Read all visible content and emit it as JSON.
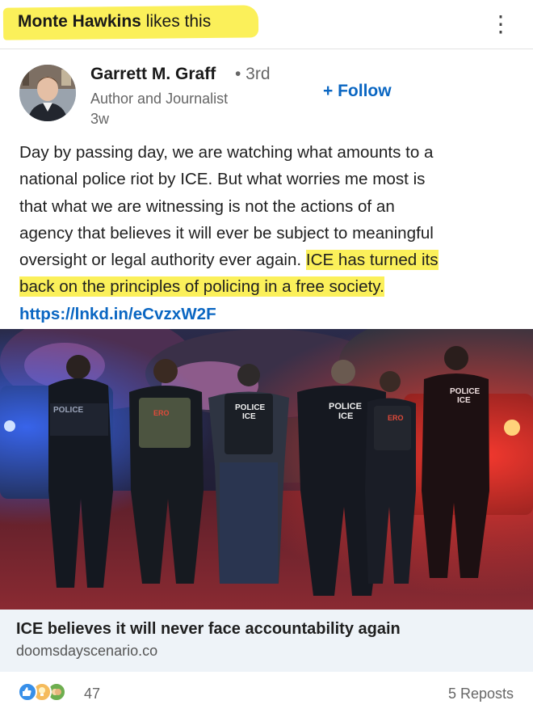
{
  "social_context": {
    "actor": "Monte Hawkins",
    "action": "likes this"
  },
  "author": {
    "name": "Garrett M. Graff",
    "degree": "• 3rd",
    "headline": "Author and Journalist",
    "age": "3w",
    "follow_label": "+ Follow"
  },
  "post": {
    "lines": [
      "Day by passing day, we are watching what amounts to a",
      "national police riot by ICE. But what worries me most is",
      "that what we are witnessing is not the actions of an",
      "agency that believes it will ever be subject to meaningful"
    ],
    "line5_plain": "oversight or legal authority ever again. ",
    "line5_highlight": "ICE has turned its",
    "line6_highlight": "back on the principles of policing in a free society.",
    "link": "https://lnkd.in/eCvzxW2F"
  },
  "image": {
    "vest_labels": [
      "POLICE",
      "ERO",
      "POLICE ICE",
      "POLICE ICE",
      "ERO",
      "POLICE ICE"
    ],
    "vest_label_texts": {
      "police": "POLICE",
      "ero": "ERO",
      "ice": "ICE"
    }
  },
  "article": {
    "title": "ICE believes it will never face accountability again",
    "source": "doomsdayscenario.co"
  },
  "engagement": {
    "reaction_count": "47",
    "reposts": "5 Reposts",
    "reaction_icons": [
      "like-icon",
      "insightful-icon",
      "celebrate-icon"
    ]
  },
  "colors": {
    "accent": "#0a66c2",
    "highlight": "#fbf05a"
  }
}
